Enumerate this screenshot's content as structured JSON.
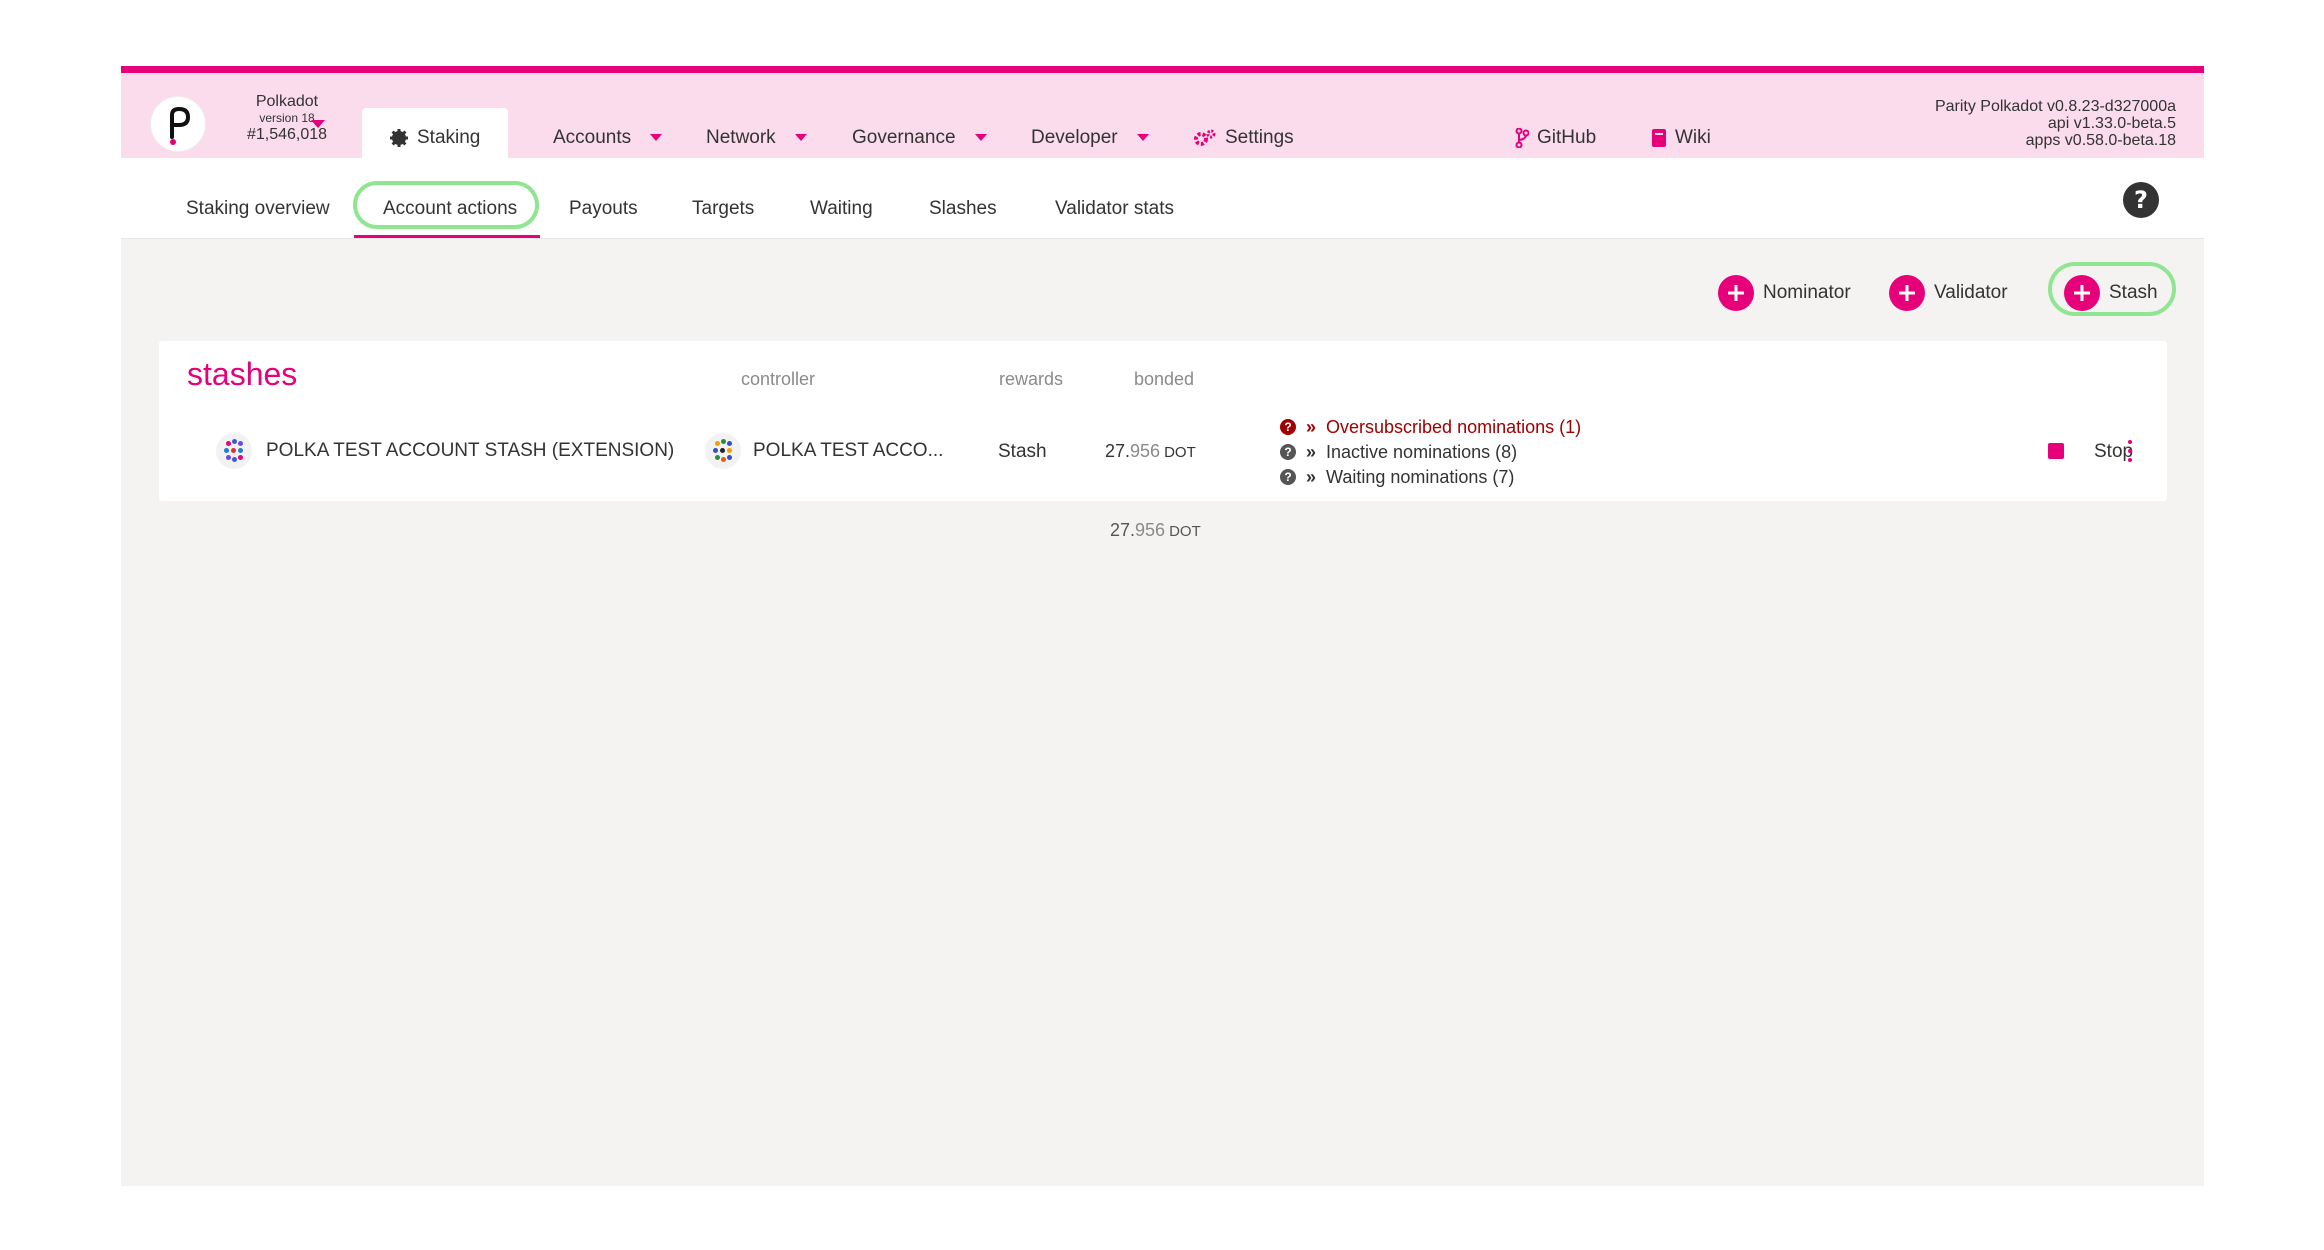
{
  "chain": {
    "name": "Polkadot",
    "version": "version 18",
    "block": "#1,546,018"
  },
  "topnav": {
    "active_tab": "Staking",
    "items": [
      {
        "label": "Accounts",
        "has_caret": true
      },
      {
        "label": "Network",
        "has_caret": true
      },
      {
        "label": "Governance",
        "has_caret": true
      },
      {
        "label": "Developer",
        "has_caret": true
      },
      {
        "label": "Settings",
        "has_caret": false
      },
      {
        "label": "GitHub",
        "has_caret": false
      },
      {
        "label": "Wiki",
        "has_caret": false
      }
    ],
    "version_lines": [
      "Parity Polkadot v0.8.23-d327000a",
      "api v1.33.0-beta.5",
      "apps v0.58.0-beta.18"
    ]
  },
  "subnav": {
    "tabs": [
      "Staking overview",
      "Account actions",
      "Payouts",
      "Targets",
      "Waiting",
      "Slashes",
      "Validator stats"
    ],
    "active": "Account actions"
  },
  "actions": {
    "nominator": "Nominator",
    "validator": "Validator",
    "stash": "Stash"
  },
  "stashes": {
    "title": "stashes",
    "headers": {
      "controller": "controller",
      "rewards": "rewards",
      "bonded": "bonded"
    },
    "row": {
      "stash_name": "POLKA TEST ACCOUNT STASH (EXTENSION)",
      "controller_name": "POLKA TEST ACCO...",
      "rewards": "Stash",
      "bonded_int": "27.",
      "bonded_dec": "956",
      "bonded_unit": "DOT",
      "nominations": [
        {
          "text": "Oversubscribed nominations (1)",
          "severity": "error"
        },
        {
          "text": "Inactive nominations (8)",
          "severity": "info"
        },
        {
          "text": "Waiting nominations (7)",
          "severity": "info"
        }
      ],
      "stop_label": "Stop"
    },
    "total_int": "27.",
    "total_dec": "956",
    "total_unit": "DOT"
  },
  "colors": {
    "accent": "#e6007a",
    "nav_bg": "#fadcec",
    "highlight": "#90e590",
    "error": "#a10000"
  }
}
